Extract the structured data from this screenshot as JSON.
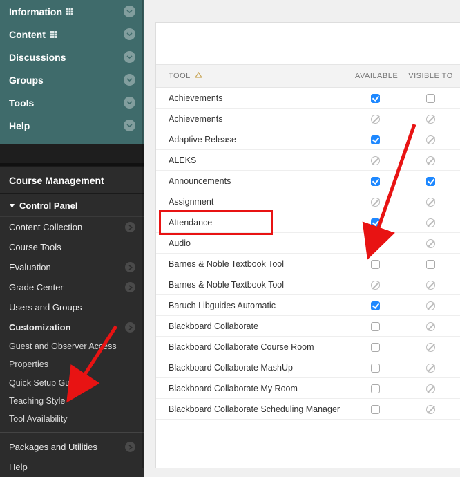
{
  "sidebar": {
    "teal_items": [
      {
        "label": "Information",
        "grid": true
      },
      {
        "label": "Content",
        "grid": true
      },
      {
        "label": "Discussions",
        "grid": false
      },
      {
        "label": "Groups",
        "grid": false
      },
      {
        "label": "Tools",
        "grid": false
      },
      {
        "label": "Help",
        "grid": false
      }
    ],
    "course_mgmt_title": "Course Management",
    "control_panel_title": "Control Panel",
    "cp_items": [
      {
        "label": "Content Collection",
        "arrow": true
      },
      {
        "label": "Course Tools",
        "arrow": false
      },
      {
        "label": "Evaluation",
        "arrow": true
      },
      {
        "label": "Grade Center",
        "arrow": true
      },
      {
        "label": "Users and Groups",
        "arrow": false
      }
    ],
    "customization": {
      "label": "Customization",
      "children": [
        "Guest and Observer Access",
        "Properties",
        "Quick Setup Guide",
        "Teaching Style",
        "Tool Availability"
      ]
    },
    "tail_items": [
      {
        "label": "Packages and Utilities",
        "arrow": true
      },
      {
        "label": "Help",
        "arrow": false
      }
    ]
  },
  "table": {
    "headers": {
      "tool": "TOOL",
      "available": "AVAILABLE",
      "visible": "VISIBLE TO"
    },
    "rows": [
      {
        "tool": "Achievements",
        "avail": "checked",
        "vis": "empty"
      },
      {
        "tool": "Achievements",
        "avail": "no",
        "vis": "no"
      },
      {
        "tool": "Adaptive Release",
        "avail": "checked",
        "vis": "no"
      },
      {
        "tool": "ALEKS",
        "avail": "no",
        "vis": "no"
      },
      {
        "tool": "Announcements",
        "avail": "checked",
        "vis": "checked"
      },
      {
        "tool": "Assignment",
        "avail": "no",
        "vis": "no"
      },
      {
        "tool": "Attendance",
        "avail": "checked",
        "vis": "no",
        "highlight": true
      },
      {
        "tool": "Audio",
        "avail": "no",
        "vis": "no"
      },
      {
        "tool": "Barnes & Noble Textbook Tool",
        "avail": "empty",
        "vis": "empty"
      },
      {
        "tool": "Barnes & Noble Textbook Tool",
        "avail": "no",
        "vis": "no"
      },
      {
        "tool": "Baruch Libguides Automatic",
        "avail": "checked",
        "vis": "no"
      },
      {
        "tool": "Blackboard Collaborate",
        "avail": "empty",
        "vis": "no"
      },
      {
        "tool": "Blackboard Collaborate Course Room",
        "avail": "empty",
        "vis": "no"
      },
      {
        "tool": "Blackboard Collaborate MashUp",
        "avail": "empty",
        "vis": "no"
      },
      {
        "tool": "Blackboard Collaborate My Room",
        "avail": "empty",
        "vis": "no"
      },
      {
        "tool": "Blackboard Collaborate Scheduling Manager",
        "avail": "empty",
        "vis": "no"
      }
    ]
  },
  "colors": {
    "accent_red": "#e81313",
    "accent_blue": "#1e88ff",
    "teal": "#3f6b6b"
  }
}
